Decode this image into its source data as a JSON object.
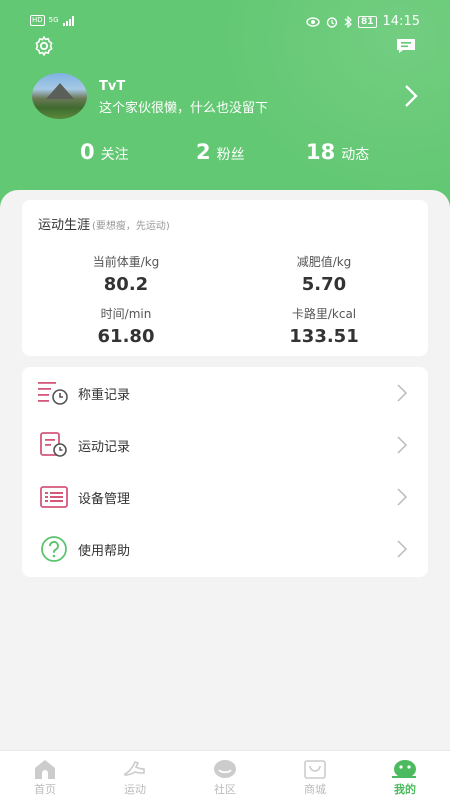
{
  "status_bar": {
    "network_tags": [
      "HD",
      "5G"
    ],
    "battery": "81",
    "time": "14:15"
  },
  "header": {
    "settings_icon": "gear-icon",
    "message_icon": "message-icon"
  },
  "profile": {
    "username": "TvT",
    "bio": "这个家伙很懒，什么也没留下"
  },
  "stats": [
    {
      "value": "0",
      "label": "关注"
    },
    {
      "value": "2",
      "label": "粉丝"
    },
    {
      "value": "18",
      "label": "动态"
    }
  ],
  "career": {
    "title": "运动生涯",
    "subtitle": "(要想瘦，先运动)",
    "metrics": [
      {
        "label": "当前体重/kg",
        "value": "80.2"
      },
      {
        "label": "减肥值/kg",
        "value": "5.70"
      },
      {
        "label": "时间/min",
        "value": "61.80"
      },
      {
        "label": "卡路里/kcal",
        "value": "133.51"
      }
    ]
  },
  "menu": [
    {
      "label": "称重记录",
      "icon": "weigh-record-icon"
    },
    {
      "label": "运动记录",
      "icon": "exercise-record-icon"
    },
    {
      "label": "设备管理",
      "icon": "device-icon"
    },
    {
      "label": "使用帮助",
      "icon": "help-icon"
    }
  ],
  "tabs": [
    {
      "label": "首页",
      "icon": "home-icon"
    },
    {
      "label": "运动",
      "icon": "exercise-icon"
    },
    {
      "label": "社区",
      "icon": "community-icon"
    },
    {
      "label": "商城",
      "icon": "shop-icon"
    },
    {
      "label": "我的",
      "icon": "profile-icon",
      "active": true
    }
  ],
  "colors": {
    "accent": "#63c873",
    "active_tab": "#4cbb5f",
    "menu_icon": "#d4587a"
  }
}
